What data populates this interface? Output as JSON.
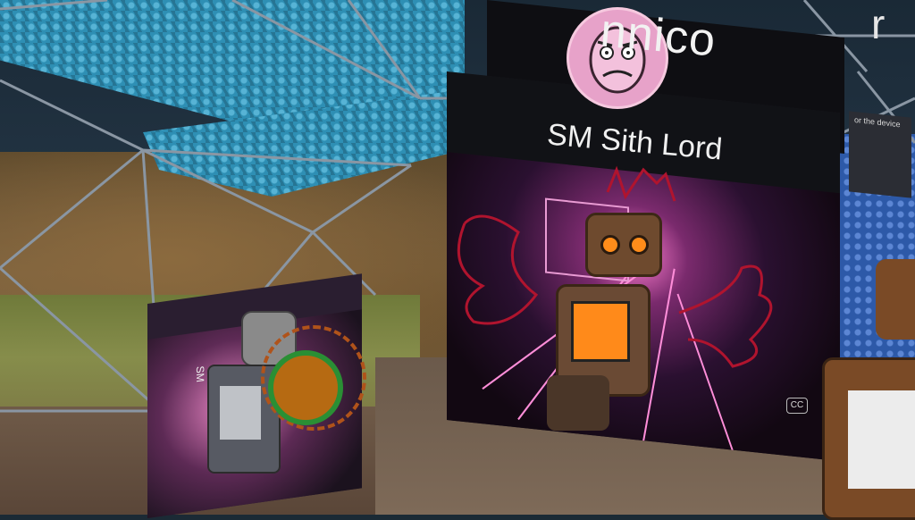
{
  "players": [
    {
      "nickname": "nnico",
      "title": "SM Sith Lord"
    }
  ],
  "side_panel_text": "or the device",
  "cc_badge": "CC",
  "partial_right_text": "r",
  "small_panel_text": "SM",
  "colors": {
    "dome_hex": "#2e8fb4",
    "frame": "#8a96a3",
    "robot_orange": "#ff8a1a",
    "tunnel_pink": "#ff7fd0",
    "scribble_red": "#b0142e"
  }
}
